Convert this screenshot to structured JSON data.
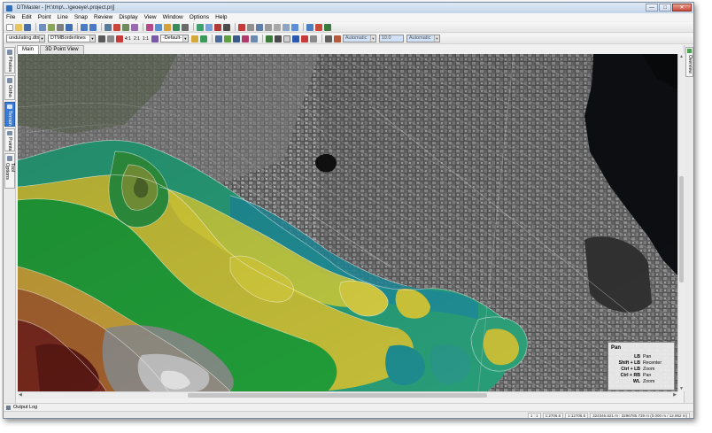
{
  "window": {
    "title": "DTMaster - [H:\\tmp\\...\\geoeye\\.project.prj]",
    "controls": [
      "—",
      "□",
      "✕"
    ]
  },
  "menu": [
    "File",
    "Edit",
    "Point",
    "Line",
    "Snap",
    "Review",
    "Display",
    "View",
    "Window",
    "Options",
    "Help"
  ],
  "toolbar2": {
    "surface_combo": "undulating.dtm",
    "line_combo": "DTMBorderlines",
    "preset_combo": "-Default-",
    "icon_labels": [
      "4:1",
      "2:1",
      "1:1"
    ],
    "right_combo_1": "Automatic",
    "right_field": "10.0",
    "right_combo_2": "Automatic"
  },
  "left_dock": {
    "tabs": [
      "Photos",
      "Ortho",
      "Terrain",
      "Points",
      "Tool Options"
    ],
    "active": "Terrain"
  },
  "right_dock": {
    "tab": "Overview"
  },
  "view_tabs": [
    "Main",
    "3D Point View"
  ],
  "active_view_tab": "Main",
  "pan_help": {
    "title": "Pan",
    "rows": [
      {
        "key": "LB",
        "action": "Pan"
      },
      {
        "key": "Shift + LB",
        "action": "Recenter"
      },
      {
        "key": "Ctrl + LB",
        "action": "Zoom"
      },
      {
        "key": "Ctrl + RB",
        "action": "Pan"
      },
      {
        "key": "WL",
        "action": "Zoom"
      }
    ]
  },
  "output_log": "Output Log",
  "status": [
    "1 : 1",
    "1:2706.6",
    "1:12706.6",
    "324346.621 m  :  3296785.739 m  (0.000 m / 12.952 m)"
  ]
}
